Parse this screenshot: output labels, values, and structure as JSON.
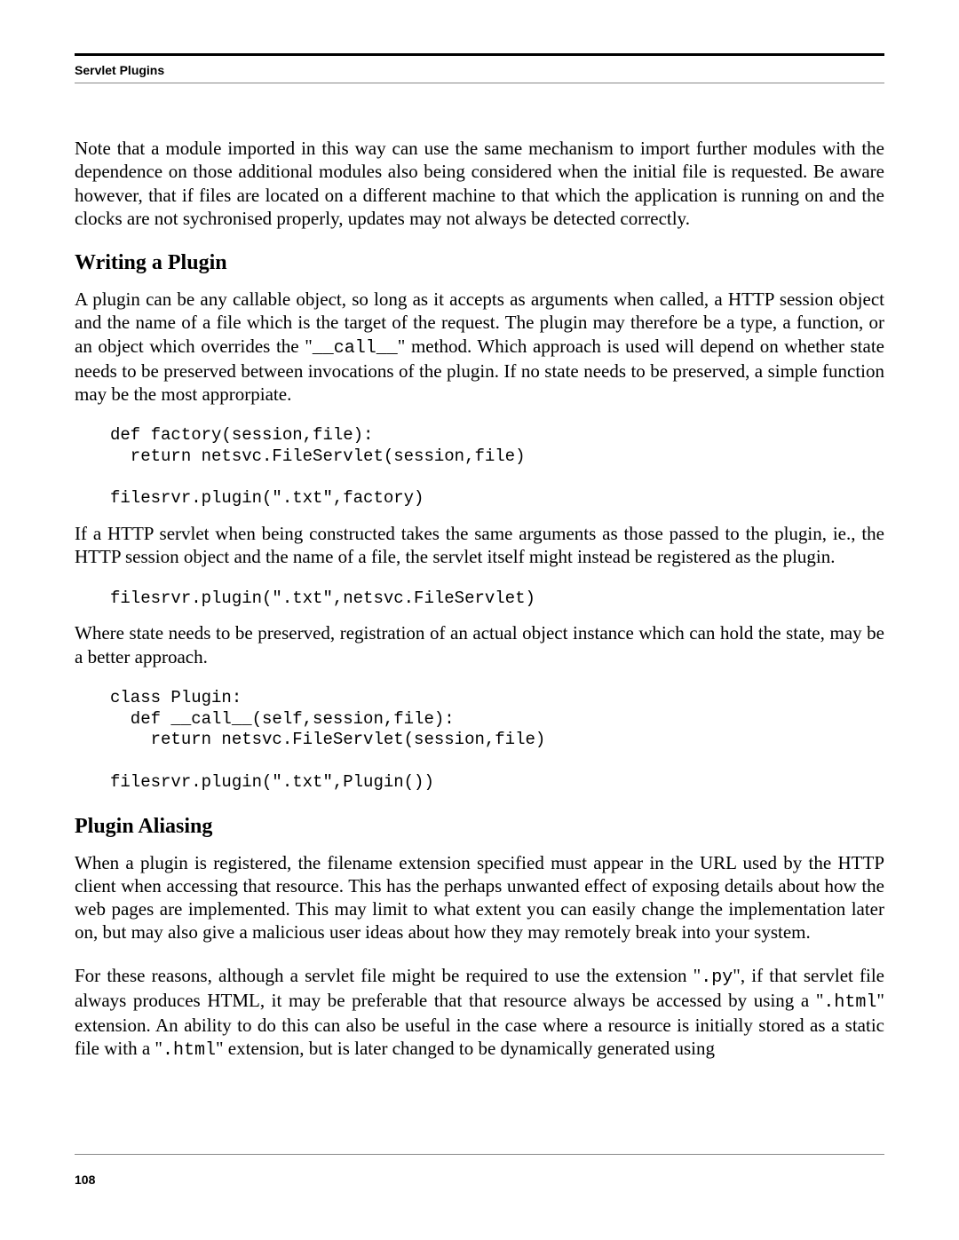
{
  "header": {
    "section": "Servlet Plugins"
  },
  "paragraphs": {
    "intro": "Note that a module imported in this way can use the same mechanism to import further modules with the dependence on those additional modules also being considered when the initial file is requested. Be aware however, that if files are located on a different machine to that which the application is running on and the clocks are not sychronised properly, updates may not always be detected correctly.",
    "writing_heading": "Writing a Plugin",
    "writing_p1_a": "A plugin can be any callable object, so long as it accepts as arguments when called, a HTTP session object and the name of a file which is the target of the request. The plugin may therefore be a type, a function, or an object which overrides the \"",
    "writing_p1_code": "__call__",
    "writing_p1_b": "\" method. Which approach is used will depend on whether state needs to be preserved between invocations of the plugin. If no state needs to be preserved, a simple function may be the most approrpiate.",
    "code1": "def factory(session,file):\n  return netsvc.FileServlet(session,file)\n\nfilesrvr.plugin(\".txt\",factory)",
    "writing_p2": "If a HTTP servlet when being constructed takes the same arguments as those passed to the plugin, ie., the HTTP session object and the name of a file, the servlet itself might instead be registered as the plugin.",
    "code2": "filesrvr.plugin(\".txt\",netsvc.FileServlet)",
    "writing_p3": "Where state needs to be preserved, registration of an actual object instance which can hold the state, may be a better approach.",
    "code3": "class Plugin:\n  def __call__(self,session,file):\n    return netsvc.FileServlet(session,file)\n\nfilesrvr.plugin(\".txt\",Plugin())",
    "aliasing_heading": "Plugin Aliasing",
    "aliasing_p1": "When a plugin is registered, the filename extension specified must appear in the URL used by the HTTP client when accessing that resource. This has the perhaps unwanted effect of exposing details about how the web pages are implemented. This may limit to what extent you can easily change the implementation later on, but may also give a malicious user ideas about how they may remotely break into your system.",
    "aliasing_p2_a": "For these reasons, although a servlet file might be required to use the extension \"",
    "aliasing_p2_code1": ".py",
    "aliasing_p2_b": "\", if that servlet file always produces HTML, it may be preferable that that resource always be accessed by using a \"",
    "aliasing_p2_code2": ".html",
    "aliasing_p2_c": "\" extension. An ability to do this can also be useful in the case where a resource is initially stored as a static file with a \"",
    "aliasing_p2_code3": ".html",
    "aliasing_p2_d": "\" extension, but is later changed to be dynamically generated using"
  },
  "footer": {
    "page_number": "108"
  }
}
